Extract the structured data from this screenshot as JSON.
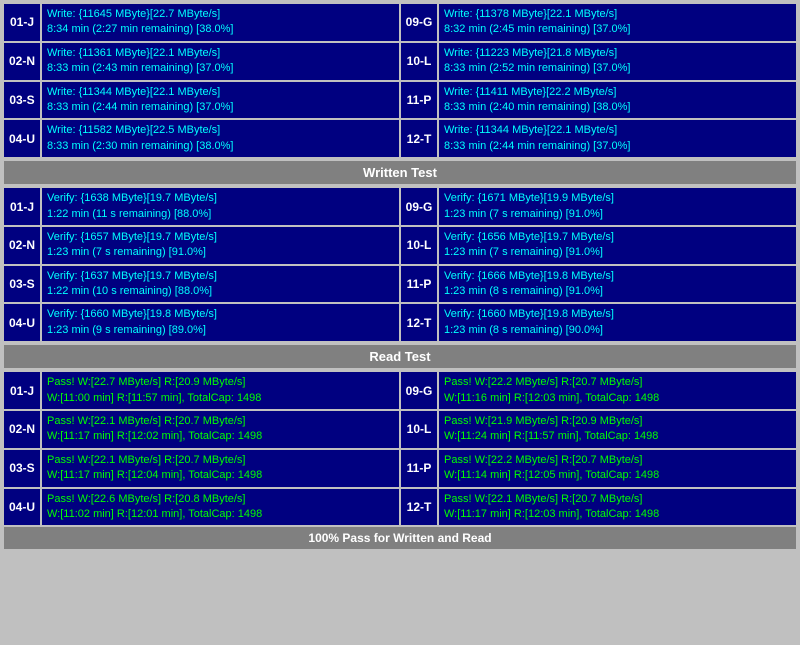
{
  "sections": {
    "written_test": {
      "label": "Written Test",
      "write_rows": [
        {
          "id_left": "01-J",
          "left_line1": "Write: {11645 MByte}[22.7 MByte/s]",
          "left_line2": "8:34 min (2:27 min remaining)  [38.0%]",
          "id_right": "09-G",
          "right_line1": "Write: {11378 MByte}[22.1 MByte/s]",
          "right_line2": "8:32 min (2:45 min remaining)  [37.0%]"
        },
        {
          "id_left": "02-N",
          "left_line1": "Write: {11361 MByte}[22.1 MByte/s]",
          "left_line2": "8:33 min (2:43 min remaining)  [37.0%]",
          "id_right": "10-L",
          "right_line1": "Write: {11223 MByte}[21.8 MByte/s]",
          "right_line2": "8:33 min (2:52 min remaining)  [37.0%]"
        },
        {
          "id_left": "03-S",
          "left_line1": "Write: {11344 MByte}[22.1 MByte/s]",
          "left_line2": "8:33 min (2:44 min remaining)  [37.0%]",
          "id_right": "11-P",
          "right_line1": "Write: {11411 MByte}[22.2 MByte/s]",
          "right_line2": "8:33 min (2:40 min remaining)  [38.0%]"
        },
        {
          "id_left": "04-U",
          "left_line1": "Write: {11582 MByte}[22.5 MByte/s]",
          "left_line2": "8:33 min (2:30 min remaining)  [38.0%]",
          "id_right": "12-T",
          "right_line1": "Write: {11344 MByte}[22.1 MByte/s]",
          "right_line2": "8:33 min (2:44 min remaining)  [37.0%]"
        }
      ],
      "verify_header": "Written Test",
      "verify_rows": [
        {
          "id_left": "01-J",
          "left_line1": "Verify: {1638 MByte}[19.7 MByte/s]",
          "left_line2": "1:22 min (11 s remaining)  [88.0%]",
          "id_right": "09-G",
          "right_line1": "Verify: {1671 MByte}[19.9 MByte/s]",
          "right_line2": "1:23 min (7 s remaining)  [91.0%]"
        },
        {
          "id_left": "02-N",
          "left_line1": "Verify: {1657 MByte}[19.7 MByte/s]",
          "left_line2": "1:23 min (7 s remaining)  [91.0%]",
          "id_right": "10-L",
          "right_line1": "Verify: {1656 MByte}[19.7 MByte/s]",
          "right_line2": "1:23 min (7 s remaining)  [91.0%]"
        },
        {
          "id_left": "03-S",
          "left_line1": "Verify: {1637 MByte}[19.7 MByte/s]",
          "left_line2": "1:22 min (10 s remaining)  [88.0%]",
          "id_right": "11-P",
          "right_line1": "Verify: {1666 MByte}[19.8 MByte/s]",
          "right_line2": "1:23 min (8 s remaining)  [91.0%]"
        },
        {
          "id_left": "04-U",
          "left_line1": "Verify: {1660 MByte}[19.8 MByte/s]",
          "left_line2": "1:23 min (9 s remaining)  [89.0%]",
          "id_right": "12-T",
          "right_line1": "Verify: {1660 MByte}[19.8 MByte/s]",
          "right_line2": "1:23 min (8 s remaining)  [90.0%]"
        }
      ]
    },
    "read_test": {
      "label": "Read Test",
      "pass_rows": [
        {
          "id_left": "01-J",
          "left_line1": "Pass! W:[22.7 MByte/s] R:[20.9 MByte/s]",
          "left_line2": "W:[11:00 min] R:[11:57 min], TotalCap: 1498",
          "id_right": "09-G",
          "right_line1": "Pass! W:[22.2 MByte/s] R:[20.7 MByte/s]",
          "right_line2": "W:[11:16 min] R:[12:03 min], TotalCap: 1498"
        },
        {
          "id_left": "02-N",
          "left_line1": "Pass! W:[22.1 MByte/s] R:[20.7 MByte/s]",
          "left_line2": "W:[11:17 min] R:[12:02 min], TotalCap: 1498",
          "id_right": "10-L",
          "right_line1": "Pass! W:[21.9 MByte/s] R:[20.9 MByte/s]",
          "right_line2": "W:[11:24 min] R:[11:57 min], TotalCap: 1498"
        },
        {
          "id_left": "03-S",
          "left_line1": "Pass! W:[22.1 MByte/s] R:[20.7 MByte/s]",
          "left_line2": "W:[11:17 min] R:[12:04 min], TotalCap: 1498",
          "id_right": "11-P",
          "right_line1": "Pass! W:[22.2 MByte/s] R:[20.7 MByte/s]",
          "right_line2": "W:[11:14 min] R:[12:05 min], TotalCap: 1498"
        },
        {
          "id_left": "04-U",
          "left_line1": "Pass! W:[22.6 MByte/s] R:[20.8 MByte/s]",
          "left_line2": "W:[11:02 min] R:[12:01 min], TotalCap: 1498",
          "id_right": "12-T",
          "right_line1": "Pass! W:[22.1 MByte/s] R:[20.7 MByte/s]",
          "right_line2": "W:[11:17 min] R:[12:03 min], TotalCap: 1498"
        }
      ]
    },
    "status_bar": "100% Pass for Written and Read"
  }
}
